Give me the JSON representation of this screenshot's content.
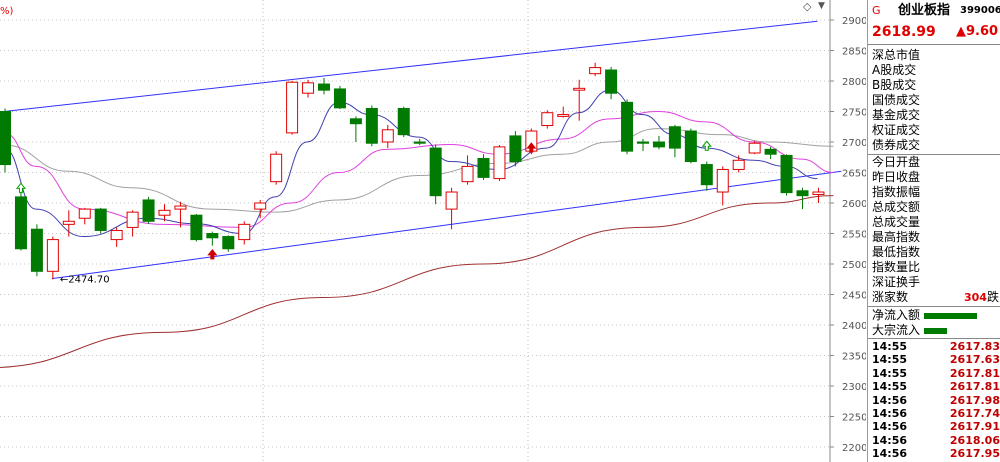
{
  "header": {
    "percent_label": "%)",
    "diamond_glyph": "◇",
    "arrow_glyph": "▼"
  },
  "quote": {
    "tag": "G",
    "name": "创业板指",
    "code": "399006",
    "price": "2618.99",
    "change": "▲9.60"
  },
  "fields": [
    "深总市值",
    "A股成交",
    "B股成交",
    "国债成交",
    "基金成交",
    "权证成交",
    "债券成交",
    "今日开盘",
    "昨日收盘",
    "指数振幅",
    "总成交额",
    "总成交量",
    "最高指数",
    "最低指数",
    "指数量比",
    "深证换手"
  ],
  "breadth": {
    "label": "涨家数",
    "count": "304",
    "suffix": "跌"
  },
  "flows": [
    {
      "label": "净流入额",
      "ratio": 1.0
    },
    {
      "label": "大宗流入",
      "ratio": 0.43
    }
  ],
  "ticks": [
    {
      "time": "14:55",
      "price": "2617.83"
    },
    {
      "time": "14:55",
      "price": "2617.63"
    },
    {
      "time": "14:55",
      "price": "2617.81"
    },
    {
      "time": "14:55",
      "price": "2617.81"
    },
    {
      "time": "14:56",
      "price": "2617.98"
    },
    {
      "time": "14:56",
      "price": "2617.74"
    },
    {
      "time": "14:56",
      "price": "2617.91"
    },
    {
      "time": "14:56",
      "price": "2618.06"
    },
    {
      "time": "14:56",
      "price": "2617.95"
    }
  ],
  "colors": {
    "up": "#e00000",
    "down": "#007a00",
    "ma5": "#4040b0",
    "ma10": "#e040e0",
    "ma20": "#a0a0a0",
    "ma_long": "#a03030",
    "channel": "#3030ff"
  },
  "chart_data": {
    "type": "candlestick",
    "y_axis": {
      "ylim": [
        2200,
        2920
      ],
      "ticks": [
        2200,
        2250,
        2300,
        2350,
        2400,
        2450,
        2500,
        2550,
        2600,
        2650,
        2700,
        2750,
        2800,
        2850,
        2900
      ]
    },
    "annotation": {
      "text": "←2474.70",
      "value": 2474.7
    },
    "candles": [
      {
        "o": 2750,
        "c": 2663,
        "h": 2755,
        "l": 2650
      },
      {
        "o": 2610,
        "c": 2525,
        "h": 2618,
        "l": 2522
      },
      {
        "o": 2557,
        "c": 2488,
        "h": 2565,
        "l": 2480
      },
      {
        "o": 2488,
        "c": 2540,
        "h": 2545,
        "l": 2475
      },
      {
        "o": 2565,
        "c": 2570,
        "h": 2588,
        "l": 2545
      },
      {
        "o": 2575,
        "c": 2590,
        "h": 2592,
        "l": 2565
      },
      {
        "o": 2590,
        "c": 2555,
        "h": 2592,
        "l": 2550
      },
      {
        "o": 2540,
        "c": 2555,
        "h": 2560,
        "l": 2528
      },
      {
        "o": 2560,
        "c": 2585,
        "h": 2588,
        "l": 2545
      },
      {
        "o": 2605,
        "c": 2570,
        "h": 2610,
        "l": 2566
      },
      {
        "o": 2580,
        "c": 2588,
        "h": 2598,
        "l": 2570
      },
      {
        "o": 2590,
        "c": 2595,
        "h": 2602,
        "l": 2560
      },
      {
        "o": 2580,
        "c": 2540,
        "h": 2582,
        "l": 2537
      },
      {
        "o": 2550,
        "c": 2543,
        "h": 2553,
        "l": 2530
      },
      {
        "o": 2545,
        "c": 2525,
        "h": 2547,
        "l": 2520
      },
      {
        "o": 2540,
        "c": 2565,
        "h": 2570,
        "l": 2532
      },
      {
        "o": 2590,
        "c": 2600,
        "h": 2605,
        "l": 2575
      },
      {
        "o": 2635,
        "c": 2680,
        "h": 2685,
        "l": 2630
      },
      {
        "o": 2715,
        "c": 2798,
        "h": 2800,
        "l": 2712
      },
      {
        "o": 2780,
        "c": 2797,
        "h": 2802,
        "l": 2773
      },
      {
        "o": 2795,
        "c": 2785,
        "h": 2805,
        "l": 2778
      },
      {
        "o": 2787,
        "c": 2756,
        "h": 2792,
        "l": 2754
      },
      {
        "o": 2738,
        "c": 2730,
        "h": 2742,
        "l": 2700
      },
      {
        "o": 2755,
        "c": 2698,
        "h": 2760,
        "l": 2693
      },
      {
        "o": 2700,
        "c": 2720,
        "h": 2728,
        "l": 2690
      },
      {
        "o": 2755,
        "c": 2712,
        "h": 2758,
        "l": 2708
      },
      {
        "o": 2700,
        "c": 2698,
        "h": 2705,
        "l": 2695
      },
      {
        "o": 2690,
        "c": 2612,
        "h": 2696,
        "l": 2598
      },
      {
        "o": 2590,
        "c": 2618,
        "h": 2625,
        "l": 2557
      },
      {
        "o": 2635,
        "c": 2660,
        "h": 2678,
        "l": 2630
      },
      {
        "o": 2673,
        "c": 2642,
        "h": 2680,
        "l": 2638
      },
      {
        "o": 2640,
        "c": 2692,
        "h": 2695,
        "l": 2636
      },
      {
        "o": 2710,
        "c": 2668,
        "h": 2718,
        "l": 2660
      },
      {
        "o": 2685,
        "c": 2718,
        "h": 2722,
        "l": 2680
      },
      {
        "o": 2727,
        "c": 2748,
        "h": 2752,
        "l": 2722
      },
      {
        "o": 2742,
        "c": 2745,
        "h": 2758,
        "l": 2740
      },
      {
        "o": 2785,
        "c": 2788,
        "h": 2802,
        "l": 2735
      },
      {
        "o": 2812,
        "c": 2822,
        "h": 2830,
        "l": 2808
      },
      {
        "o": 2818,
        "c": 2780,
        "h": 2823,
        "l": 2770
      },
      {
        "o": 2765,
        "c": 2685,
        "h": 2770,
        "l": 2680
      },
      {
        "o": 2700,
        "c": 2698,
        "h": 2705,
        "l": 2685
      },
      {
        "o": 2700,
        "c": 2692,
        "h": 2710,
        "l": 2688
      },
      {
        "o": 2725,
        "c": 2690,
        "h": 2728,
        "l": 2675
      },
      {
        "o": 2718,
        "c": 2668,
        "h": 2722,
        "l": 2665
      },
      {
        "o": 2663,
        "c": 2630,
        "h": 2668,
        "l": 2620
      },
      {
        "o": 2618,
        "c": 2655,
        "h": 2660,
        "l": 2596
      },
      {
        "o": 2655,
        "c": 2670,
        "h": 2678,
        "l": 2650
      },
      {
        "o": 2682,
        "c": 2698,
        "h": 2702,
        "l": 2680
      },
      {
        "o": 2688,
        "c": 2680,
        "h": 2692,
        "l": 2672
      },
      {
        "o": 2678,
        "c": 2617,
        "h": 2680,
        "l": 2612
      },
      {
        "o": 2620,
        "c": 2612,
        "h": 2625,
        "l": 2590
      },
      {
        "o": 2614,
        "c": 2618,
        "h": 2625,
        "l": 2600
      }
    ],
    "channel_upper": [
      {
        "i": 0,
        "v": 2750
      },
      {
        "i": 51,
        "v": 2898
      }
    ],
    "channel_lower": [
      {
        "i": 3,
        "v": 2476
      },
      {
        "i": 52.5,
        "v": 2652
      }
    ],
    "ma_long": [
      {
        "i": -1,
        "v": 2330
      },
      {
        "i": 10,
        "v": 2388
      },
      {
        "i": 20,
        "v": 2445
      },
      {
        "i": 30,
        "v": 2500
      },
      {
        "i": 40,
        "v": 2560
      },
      {
        "i": 48,
        "v": 2600
      },
      {
        "i": 52,
        "v": 2612
      }
    ],
    "ma5": [
      {
        "i": 0,
        "v": 2690
      },
      {
        "i": 2,
        "v": 2590
      },
      {
        "i": 5,
        "v": 2545
      },
      {
        "i": 9,
        "v": 2575
      },
      {
        "i": 12,
        "v": 2566
      },
      {
        "i": 15,
        "v": 2550
      },
      {
        "i": 17,
        "v": 2610
      },
      {
        "i": 19,
        "v": 2700
      },
      {
        "i": 21,
        "v": 2765
      },
      {
        "i": 23,
        "v": 2745
      },
      {
        "i": 26,
        "v": 2708
      },
      {
        "i": 28,
        "v": 2668
      },
      {
        "i": 31,
        "v": 2655
      },
      {
        "i": 34,
        "v": 2690
      },
      {
        "i": 36,
        "v": 2748
      },
      {
        "i": 38,
        "v": 2785
      },
      {
        "i": 40,
        "v": 2745
      },
      {
        "i": 42,
        "v": 2712
      },
      {
        "i": 44,
        "v": 2690
      },
      {
        "i": 47,
        "v": 2670
      },
      {
        "i": 49,
        "v": 2660
      },
      {
        "i": 51,
        "v": 2640
      }
    ],
    "ma10": [
      {
        "i": 0,
        "v": 2715
      },
      {
        "i": 2,
        "v": 2660
      },
      {
        "i": 5,
        "v": 2590
      },
      {
        "i": 10,
        "v": 2565
      },
      {
        "i": 15,
        "v": 2560
      },
      {
        "i": 18,
        "v": 2600
      },
      {
        "i": 21,
        "v": 2650
      },
      {
        "i": 24,
        "v": 2688
      },
      {
        "i": 28,
        "v": 2696
      },
      {
        "i": 31,
        "v": 2680
      },
      {
        "i": 35,
        "v": 2705
      },
      {
        "i": 38,
        "v": 2738
      },
      {
        "i": 41,
        "v": 2750
      },
      {
        "i": 44,
        "v": 2733
      },
      {
        "i": 47,
        "v": 2700
      },
      {
        "i": 50,
        "v": 2672
      },
      {
        "i": 52,
        "v": 2650
      }
    ],
    "ma20": [
      {
        "i": 0,
        "v": 2695
      },
      {
        "i": 4,
        "v": 2652
      },
      {
        "i": 8,
        "v": 2625
      },
      {
        "i": 13,
        "v": 2590
      },
      {
        "i": 17,
        "v": 2585
      },
      {
        "i": 21,
        "v": 2605
      },
      {
        "i": 26,
        "v": 2645
      },
      {
        "i": 31,
        "v": 2665
      },
      {
        "i": 35,
        "v": 2680
      },
      {
        "i": 38,
        "v": 2700
      },
      {
        "i": 41,
        "v": 2722
      },
      {
        "i": 45,
        "v": 2712
      },
      {
        "i": 48,
        "v": 2700
      },
      {
        "i": 52,
        "v": 2693
      }
    ],
    "markers": [
      {
        "i": 1,
        "kind": "up-hollow",
        "v": 2624
      },
      {
        "i": 13,
        "kind": "up-filled",
        "v": 2515
      },
      {
        "i": 33,
        "kind": "up-filled",
        "v": 2690
      },
      {
        "i": 44,
        "kind": "up-hollow",
        "v": 2693
      }
    ]
  }
}
